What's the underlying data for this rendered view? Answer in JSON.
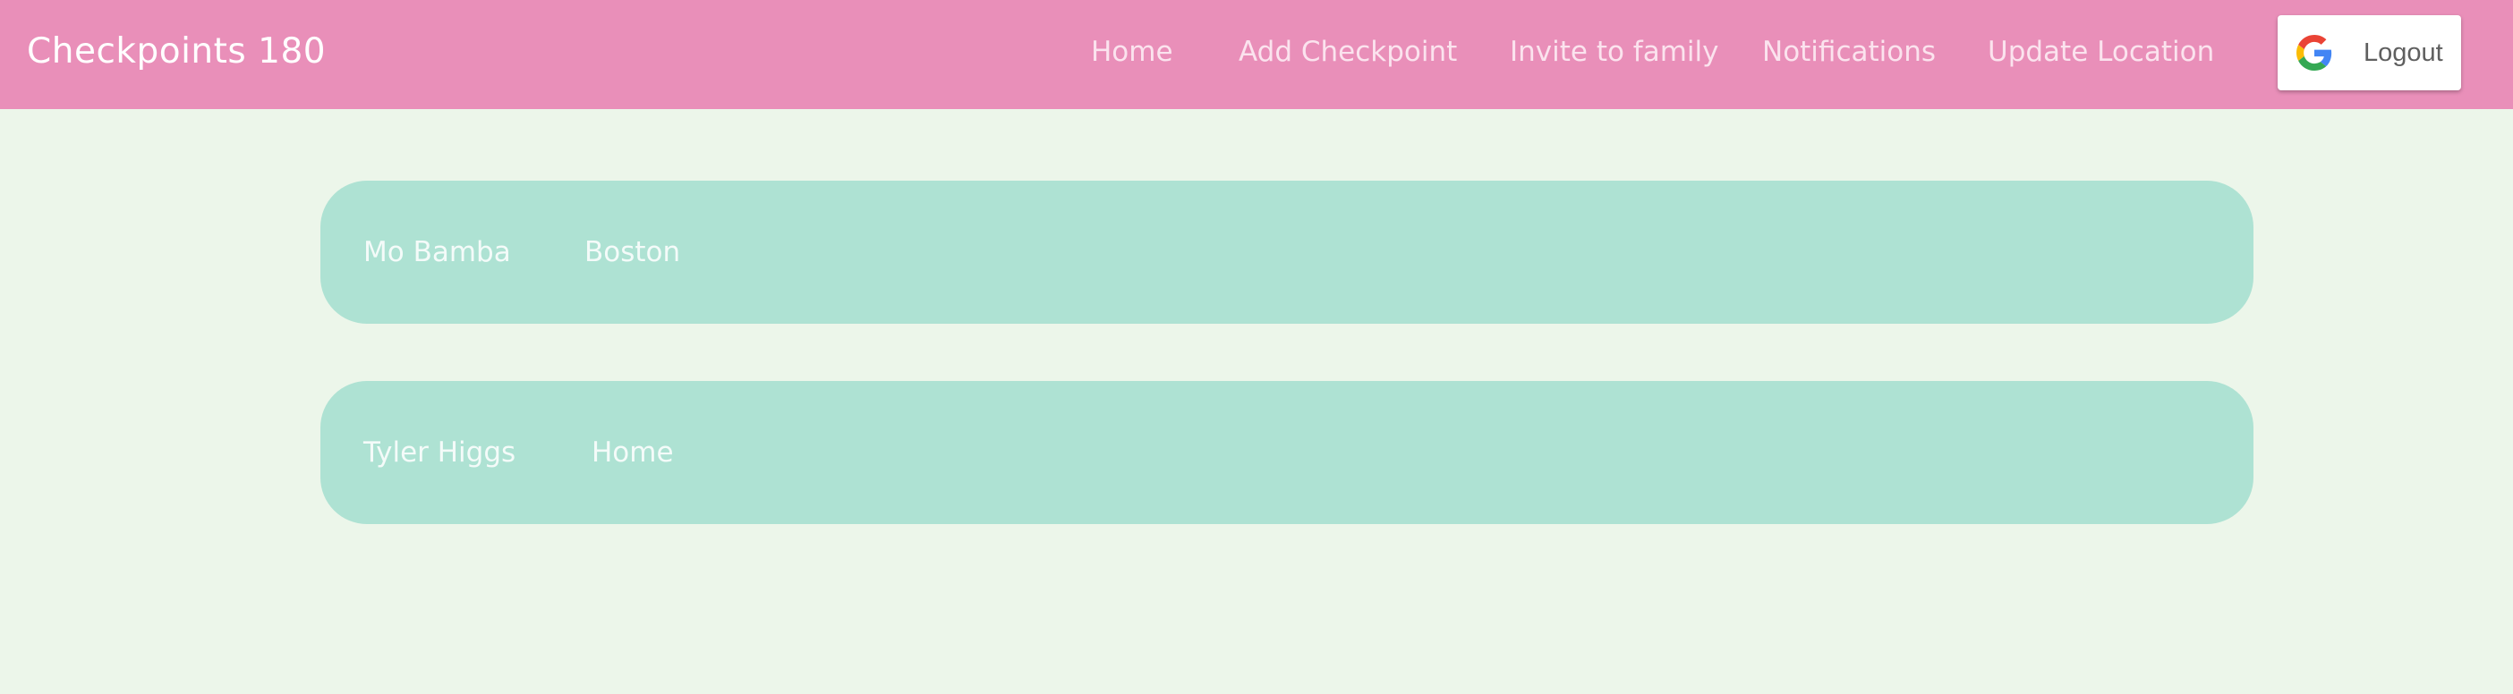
{
  "header": {
    "brand": "Checkpoints 180",
    "nav": {
      "home": "Home",
      "add_checkpoint": "Add Checkpoint",
      "invite": "Invite to family",
      "notifications": "Notifications",
      "update_location": "Update Location"
    },
    "logout": {
      "label": "Logout",
      "icon": "google-g-icon"
    }
  },
  "checkpoints": [
    {
      "name": "Mo Bamba",
      "location": "Boston"
    },
    {
      "name": "Tyler Higgs",
      "location": "Home"
    }
  ],
  "colors": {
    "navbar": "#e98fb9",
    "background": "#ecf6ea",
    "card": "#aee2d3"
  }
}
